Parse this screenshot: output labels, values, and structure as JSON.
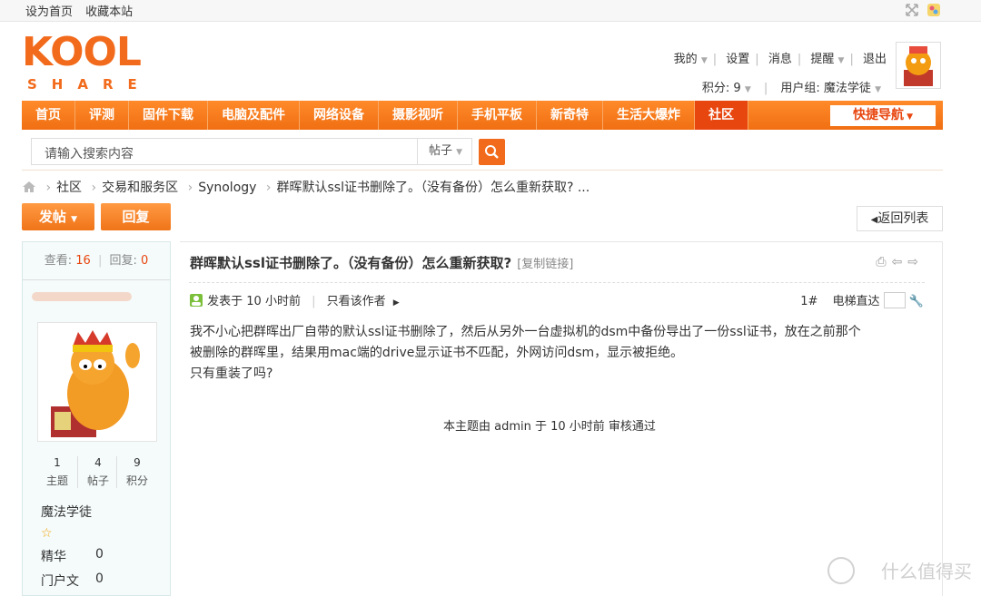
{
  "topbar": {
    "set_home": "设为首页",
    "bookmark": "收藏本站"
  },
  "logo": {
    "top": "KOOL",
    "bottom": "SHARE"
  },
  "user": {
    "menu_mine": "我的",
    "settings": "设置",
    "messages": "消息",
    "reminders": "提醒",
    "logout": "退出",
    "points": "积分: 9",
    "usergroup": "用户组: 魔法学徒"
  },
  "nav": {
    "items": [
      "首页",
      "评测",
      "固件下载",
      "电脑及配件",
      "网络设备",
      "摄影视听",
      "手机平板",
      "新奇特",
      "生活大爆炸",
      "社区"
    ],
    "active": "社区",
    "quick": "快捷导航"
  },
  "search": {
    "placeholder": "请输入搜索内容",
    "type": "帖子"
  },
  "breadcrumb": {
    "items": [
      "社区",
      "交易和服务区",
      "Synology",
      "群晖默认ssl证书删除了。（没有备份）怎么重新获取? ..."
    ]
  },
  "actions": {
    "post": "发帖",
    "reply": "回复",
    "back": "返回列表"
  },
  "sidebar": {
    "views_label": "查看:",
    "views": "16",
    "replies_label": "回复:",
    "replies": "0",
    "stats": [
      {
        "n": "1",
        "l": "主题"
      },
      {
        "n": "4",
        "l": "帖子"
      },
      {
        "n": "9",
        "l": "积分"
      }
    ],
    "rank": "魔法学徒",
    "digest_label": "精华",
    "digest": "0",
    "portal_label": "门户文",
    "portal": "0"
  },
  "post": {
    "title": "群晖默认ssl证书删除了。（没有备份）怎么重新获取?",
    "copy_link": "[复制链接]",
    "posted": "发表于 10 小时前",
    "only_author": "只看该作者",
    "floor": "1#",
    "elevator": "电梯直达",
    "body": [
      "我不小心把群晖出厂自带的默认ssl证书删除了，然后从另外一台虚拟机的dsm中备份导出了一份ssl证书，放在之前那个",
      "被删除的群晖里，结果用mac端的drive显示证书不匹配，外网访问dsm，显示被拒绝。",
      "只有重装了吗?"
    ],
    "audit": "本主题由 admin 于 10 小时前 审核通过"
  },
  "watermark": "什么值得买",
  "colors": {
    "accent": "#f26a1b",
    "active_nav": "#e8460f"
  }
}
